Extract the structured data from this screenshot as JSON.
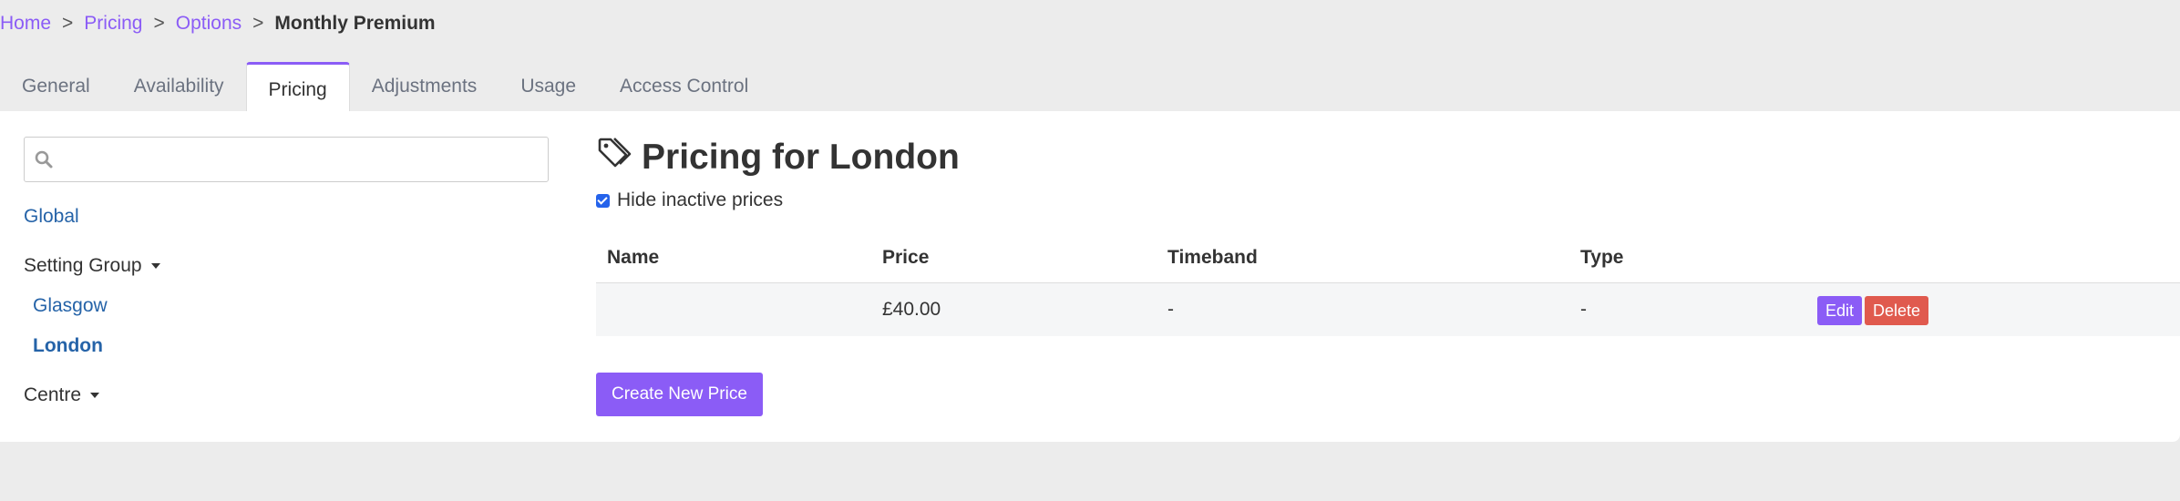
{
  "breadcrumb": {
    "items": [
      "Home",
      "Pricing",
      "Options"
    ],
    "current": "Monthly Premium",
    "separator": ">"
  },
  "tabs": [
    "General",
    "Availability",
    "Pricing",
    "Adjustments",
    "Usage",
    "Access Control"
  ],
  "active_tab": "Pricing",
  "sidebar": {
    "search_placeholder": "",
    "global_label": "Global",
    "setting_group_label": "Setting Group",
    "locations": [
      "Glasgow",
      "London"
    ],
    "selected_location": "London",
    "centre_label": "Centre"
  },
  "main": {
    "title": "Pricing for London",
    "hide_inactive_label": "Hide inactive prices",
    "hide_inactive_checked": true,
    "table": {
      "headers": [
        "Name",
        "Price",
        "Timeband",
        "Type"
      ],
      "rows": [
        {
          "name": "",
          "price": "£40.00",
          "timeband": "-",
          "type": "-"
        }
      ],
      "edit_label": "Edit",
      "delete_label": "Delete"
    },
    "create_label": "Create New Price"
  },
  "colors": {
    "accent": "#8b5cf6",
    "link": "#2563a8",
    "danger": "#e05a4e",
    "background": "#ececec"
  },
  "icons": [
    "search-icon",
    "tag-icon",
    "caret-down-icon",
    "checkbox-checked"
  ]
}
